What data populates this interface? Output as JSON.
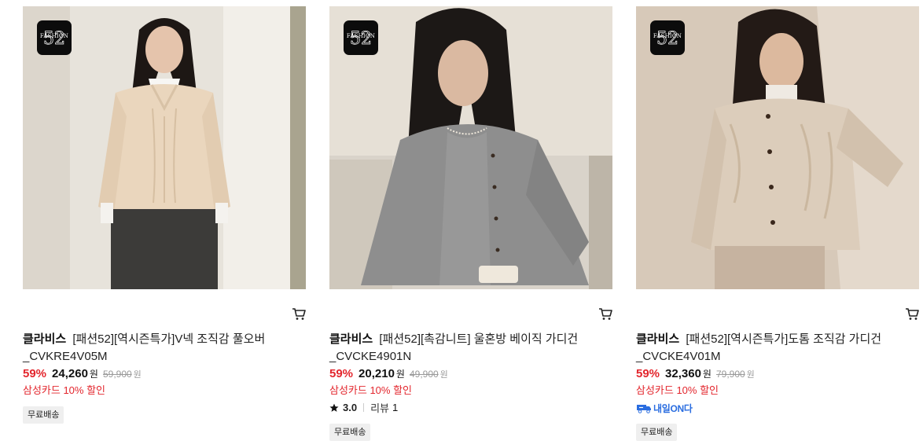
{
  "products": [
    {
      "brand": "클라비스",
      "title": "[패션52][역시즌특가]V넥 조직감 풀오버 _CVKRE4V05M",
      "discount_rate": "59%",
      "price": "24,260",
      "currency": "원",
      "original_price": "59,900",
      "card_promo": "삼성카드 10% 할인",
      "badge": "무료배송",
      "logo_text": "FASHION",
      "logo_mark": "52",
      "colors": {
        "garment": "#ead6bd",
        "bottom": "#3c3b39",
        "bg": "#e7e3db"
      }
    },
    {
      "brand": "클라비스",
      "title": "[패션52][촉감니트] 울혼방 베이직 가디건 _CVCKE4901N",
      "discount_rate": "59%",
      "price": "20,210",
      "currency": "원",
      "original_price": "49,900",
      "card_promo": "삼성카드 10% 할인",
      "rating": "3.0",
      "review_label": "리뷰",
      "review_count": "1",
      "badge": "무료배송",
      "logo_text": "FASHION",
      "logo_mark": "52",
      "colors": {
        "garment": "#8e8e8e",
        "bottom": "#7a7a7a",
        "bg": "#d9d3ca"
      }
    },
    {
      "brand": "클라비스",
      "title": "[패션52][역시즌특가]도톰 조직감 가디건 _CVCKE4V01M",
      "discount_rate": "59%",
      "price": "32,360",
      "currency": "원",
      "original_price": "79,900",
      "card_promo": "삼성카드 10% 할인",
      "delivery_tag": "내일ON다",
      "badge": "무료배송",
      "logo_text": "FASHION",
      "logo_mark": "52",
      "colors": {
        "garment": "#dccdbb",
        "bottom": "#c6b3a0",
        "bg": "#d7c9b9"
      }
    }
  ],
  "colors": {
    "discount": "#e3262d",
    "strike": "#999999",
    "badge_bg": "#efefef",
    "delivery_blue": "#2a6de0"
  }
}
